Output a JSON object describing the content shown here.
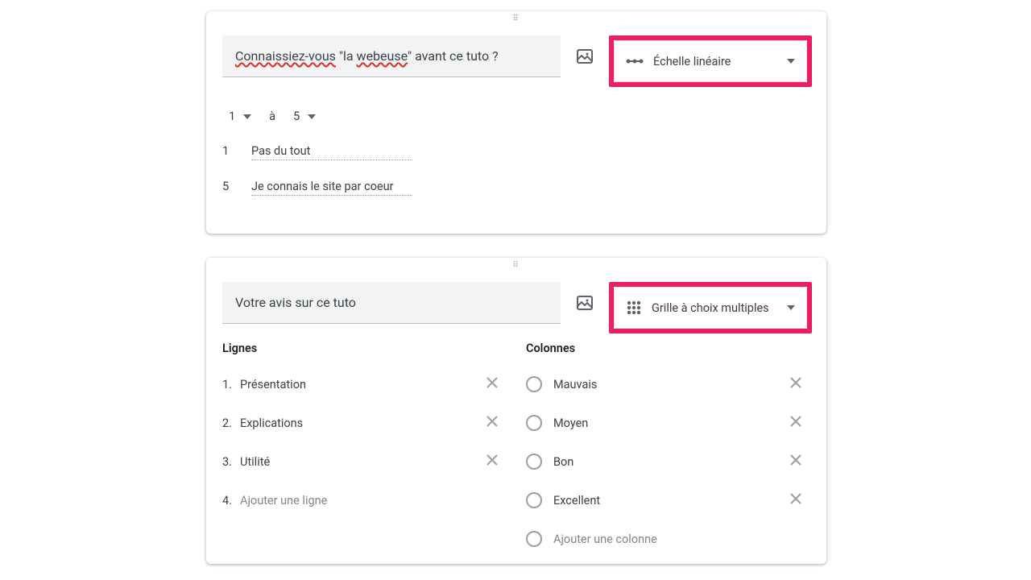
{
  "card1": {
    "title_part1": "Connaissiez-vous",
    "title_mid": " \"la ",
    "title_part2": "webeuse",
    "title_end": "\"  avant ce tuto ?",
    "type_label": "Échelle linéaire",
    "scale_from": "1",
    "scale_word": "à",
    "scale_to": "5",
    "label_min_num": "1",
    "label_min_text": "Pas du tout",
    "label_max_num": "5",
    "label_max_text": "Je connais le site par coeur"
  },
  "card2": {
    "title": "Votre avis sur ce tuto",
    "type_label": "Grille à choix multiples",
    "rows_header": "Lignes",
    "cols_header": "Colonnes",
    "rows": [
      {
        "ord": "1.",
        "text": "Présentation"
      },
      {
        "ord": "2.",
        "text": "Explications"
      },
      {
        "ord": "3.",
        "text": "Utilité"
      }
    ],
    "add_row_ord": "4.",
    "add_row_text": "Ajouter une ligne",
    "cols": [
      {
        "text": "Mauvais"
      },
      {
        "text": "Moyen"
      },
      {
        "text": "Bon"
      },
      {
        "text": "Excellent"
      }
    ],
    "add_col_text": "Ajouter une colonne"
  }
}
